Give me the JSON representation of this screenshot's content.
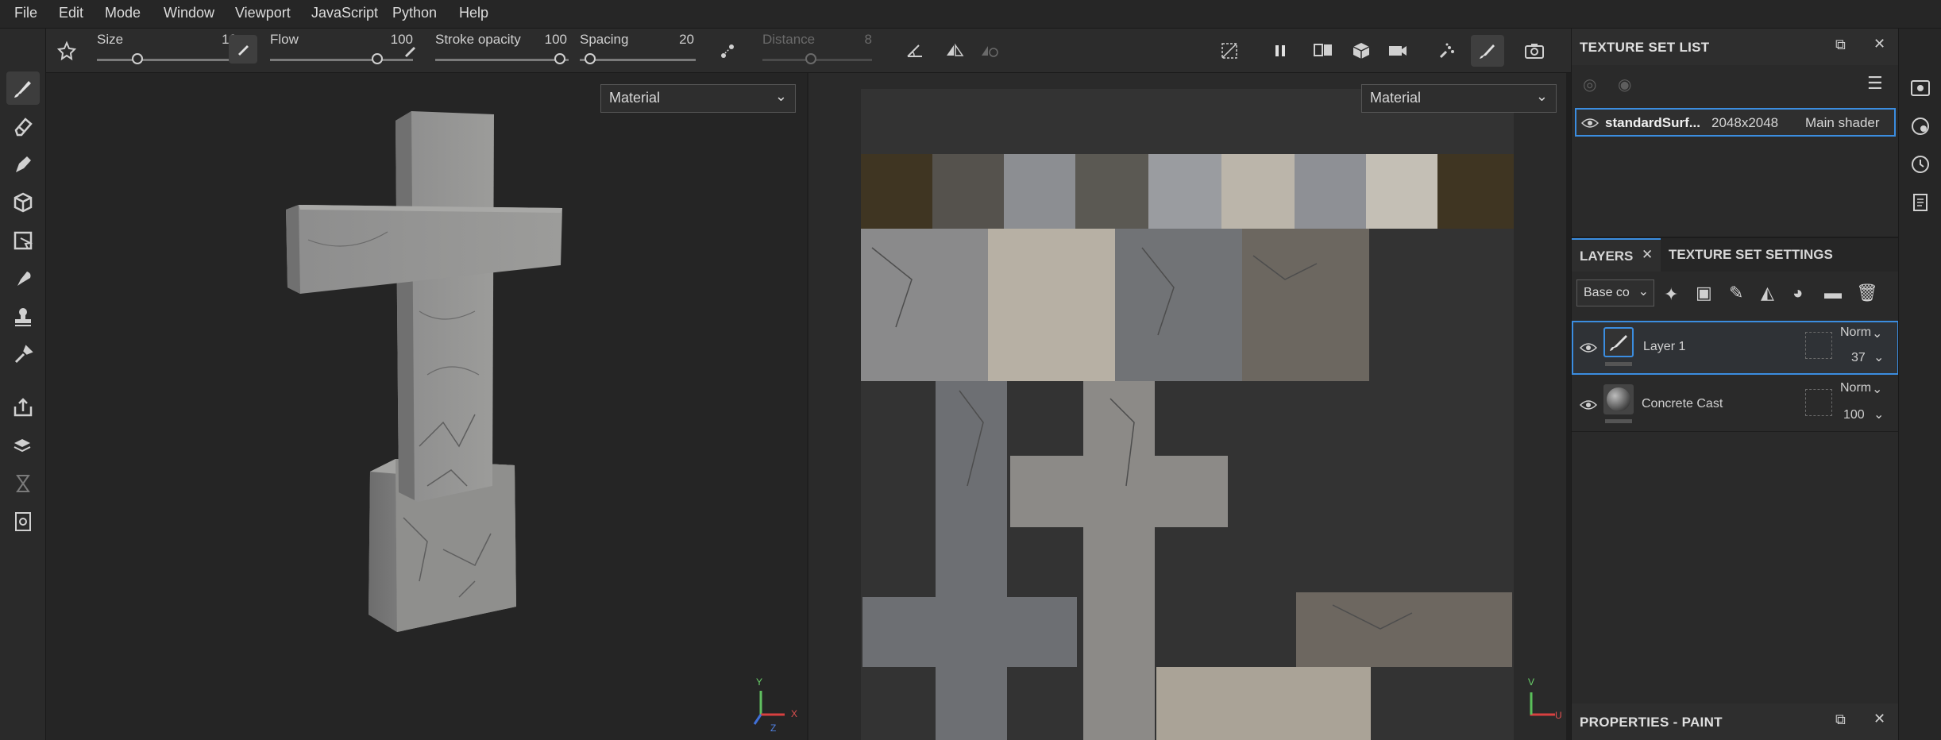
{
  "menu": [
    "File",
    "Edit",
    "Mode",
    "Window",
    "Viewport",
    "JavaScript",
    "Python",
    "Help"
  ],
  "tool_options": {
    "size_label": "Size",
    "size_value": "10",
    "flow_label": "Flow",
    "flow_value": "100",
    "stroke_opacity_label": "Stroke opacity",
    "stroke_opacity_value": "100",
    "spacing_label": "Spacing",
    "spacing_value": "20",
    "distance_label": "Distance",
    "distance_value": "8"
  },
  "viewport_3d": {
    "channel": "Material",
    "axis_y": "Y",
    "axis_x": "X",
    "axis_z": "Z"
  },
  "viewport_uv": {
    "channel": "Material",
    "axis_v": "V",
    "axis_u": "U"
  },
  "texture_set_list": {
    "title": "TEXTURE SET LIST",
    "row": {
      "name": "standardSurf...",
      "resolution": "2048x2048",
      "shader": "Main shader"
    }
  },
  "layers": {
    "tab_layers": "LAYERS",
    "tab_settings": "TEXTURE SET SETTINGS",
    "channel_select": "Base co",
    "items": [
      {
        "name": "Layer 1",
        "blend": "Norm",
        "opacity": "37",
        "type": "paint"
      },
      {
        "name": "Concrete Cast",
        "blend": "Norm",
        "opacity": "100",
        "type": "fill"
      }
    ]
  },
  "properties": {
    "title": "PROPERTIES - PAINT"
  },
  "colors": {
    "accent": "#3b8de0",
    "bg": "#1f1f1f",
    "panel": "#2a2a2a"
  }
}
